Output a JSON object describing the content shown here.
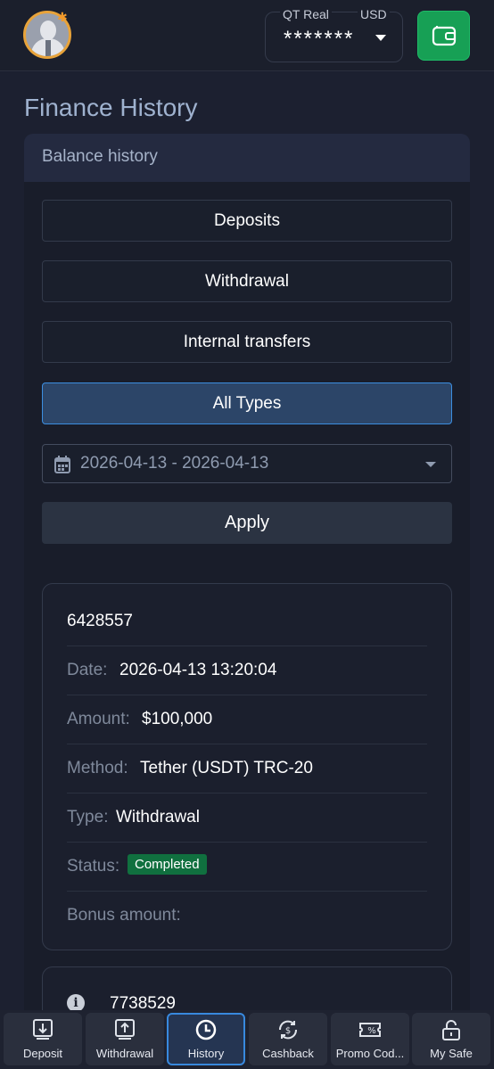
{
  "header": {
    "account_type": "QT Real",
    "currency": "USD",
    "balance_masked": "*******",
    "accent_color": "#17a055"
  },
  "page": {
    "title": "Finance History"
  },
  "balance_history": {
    "title": "Balance history",
    "filters": [
      {
        "label": "Deposits",
        "active": false
      },
      {
        "label": "Withdrawal",
        "active": false
      },
      {
        "label": "Internal transfers",
        "active": false
      },
      {
        "label": "All Types",
        "active": true
      }
    ],
    "date_range": "2026-04-13 - 2026-04-13",
    "apply_label": "Apply"
  },
  "transactions": [
    {
      "id": "6428557",
      "date_label": "Date:",
      "date": "2026-04-13 13:20:04",
      "amount_label": "Amount:",
      "amount": "$100,000",
      "method_label": "Method:",
      "method": "Tether (USDT) TRC-20",
      "type_label": "Type:",
      "type": "Withdrawal",
      "status_label": "Status:",
      "status": "Completed",
      "bonus_label": "Bonus amount:",
      "bonus": ""
    },
    {
      "id": "7738529"
    }
  ],
  "bottom_nav": [
    {
      "label": "Deposit",
      "icon": "deposit-icon",
      "active": false
    },
    {
      "label": "Withdrawal",
      "icon": "withdrawal-icon",
      "active": false
    },
    {
      "label": "History",
      "icon": "history-icon",
      "active": true
    },
    {
      "label": "Cashback",
      "icon": "cashback-icon",
      "active": false
    },
    {
      "label": "Promo Cod...",
      "icon": "promo-code-icon",
      "active": false
    },
    {
      "label": "My Safe",
      "icon": "safe-icon",
      "active": false
    }
  ]
}
